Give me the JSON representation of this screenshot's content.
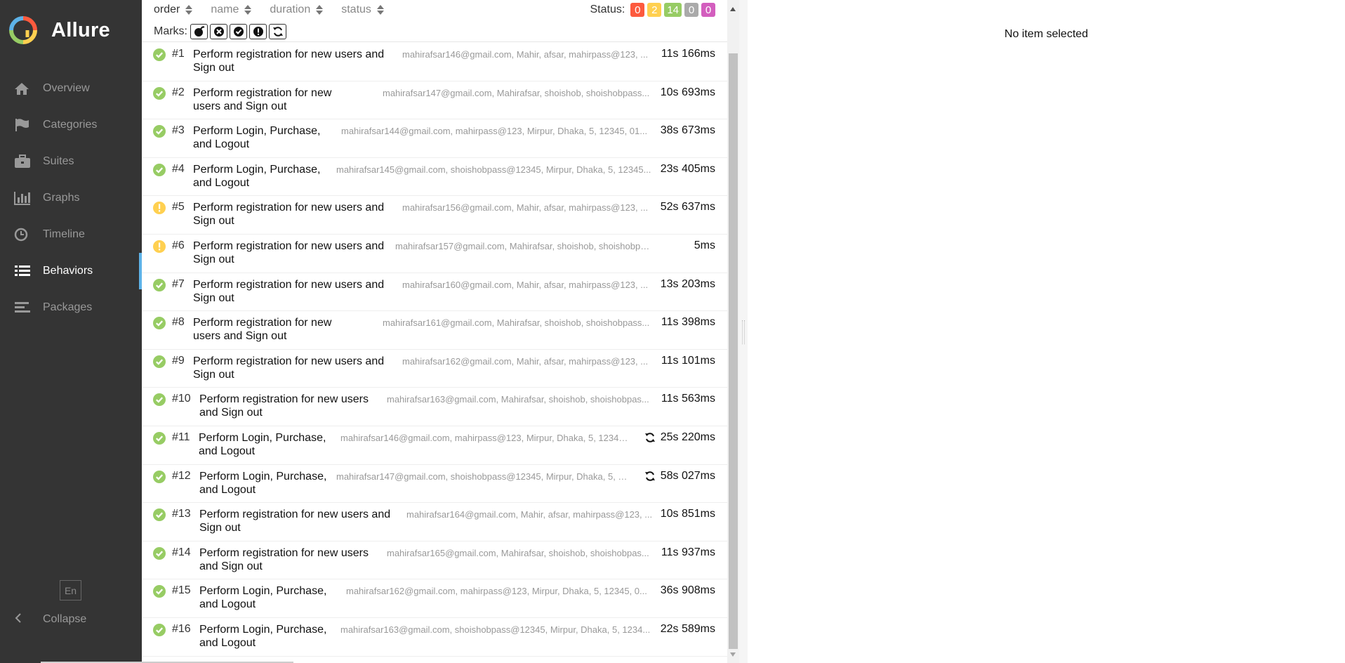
{
  "app": {
    "name": "Allure"
  },
  "sidebar": {
    "items": [
      {
        "label": "Overview",
        "icon": "home-icon"
      },
      {
        "label": "Categories",
        "icon": "flag-icon"
      },
      {
        "label": "Suites",
        "icon": "briefcase-icon"
      },
      {
        "label": "Graphs",
        "icon": "bar-chart-icon"
      },
      {
        "label": "Timeline",
        "icon": "clock-icon"
      },
      {
        "label": "Behaviors",
        "icon": "list-icon",
        "active": true
      },
      {
        "label": "Packages",
        "icon": "align-left-icon"
      }
    ],
    "language": "En",
    "collapse_label": "Collapse"
  },
  "toolbar": {
    "sorters": [
      "order",
      "name",
      "duration",
      "status"
    ],
    "status_label": "Status:",
    "statuses": [
      {
        "count": "0",
        "color": "#fd5a3e"
      },
      {
        "count": "2",
        "color": "#ffd050"
      },
      {
        "count": "14",
        "color": "#97cc64"
      },
      {
        "count": "0",
        "color": "#aaaaaa"
      },
      {
        "count": "0",
        "color": "#d35ebe"
      }
    ],
    "marks_label": "Marks:",
    "marks": [
      "flaky-icon",
      "new-failed-icon",
      "new-passed-icon",
      "new-broken-icon",
      "retries-icon"
    ]
  },
  "tests": [
    {
      "num": "#1",
      "title": "Perform registration for new users and Sign out",
      "params": "mahirafsar146@gmail.com, Mahir, afsar, mahirpass@123, ...",
      "duration": "11s 166ms",
      "status": "passed"
    },
    {
      "num": "#2",
      "title": "Perform registration for new users and Sign out",
      "params": "mahirafsar147@gmail.com, Mahirafsar, shoishob, shoishobpass...",
      "duration": "10s 693ms",
      "status": "passed"
    },
    {
      "num": "#3",
      "title": "Perform Login, Purchase, and Logout",
      "params": "mahirafsar144@gmail.com, mahirpass@123, Mirpur, Dhaka, 5, 12345, 01...",
      "duration": "38s 673ms",
      "status": "passed"
    },
    {
      "num": "#4",
      "title": "Perform Login, Purchase, and Logout",
      "params": "mahirafsar145@gmail.com, shoishobpass@12345, Mirpur, Dhaka, 5, 12345...",
      "duration": "23s 405ms",
      "status": "passed"
    },
    {
      "num": "#5",
      "title": "Perform registration for new users and Sign out",
      "params": "mahirafsar156@gmail.com, Mahir, afsar, mahirpass@123, ...",
      "duration": "52s 637ms",
      "status": "broken"
    },
    {
      "num": "#6",
      "title": "Perform registration for new users and Sign out",
      "params": "mahirafsar157@gmail.com, Mahirafsar, shoishob, shoishobpass@12...",
      "duration": "5ms",
      "status": "broken"
    },
    {
      "num": "#7",
      "title": "Perform registration for new users and Sign out",
      "params": "mahirafsar160@gmail.com, Mahir, afsar, mahirpass@123, ...",
      "duration": "13s 203ms",
      "status": "passed"
    },
    {
      "num": "#8",
      "title": "Perform registration for new users and Sign out",
      "params": "mahirafsar161@gmail.com, Mahirafsar, shoishob, shoishobpass...",
      "duration": "11s 398ms",
      "status": "passed"
    },
    {
      "num": "#9",
      "title": "Perform registration for new users and Sign out",
      "params": "mahirafsar162@gmail.com, Mahir, afsar, mahirpass@123, ...",
      "duration": "11s 101ms",
      "status": "passed"
    },
    {
      "num": "#10",
      "title": "Perform registration for new users and Sign out",
      "params": "mahirafsar163@gmail.com, Mahirafsar, shoishob, shoishobpas...",
      "duration": "11s 563ms",
      "status": "passed"
    },
    {
      "num": "#11",
      "title": "Perform Login, Purchase, and Logout",
      "params": "mahirafsar146@gmail.com, mahirpass@123, Mirpur, Dhaka, 5, 12345,...",
      "duration": "25s 220ms",
      "status": "passed",
      "retry": true
    },
    {
      "num": "#12",
      "title": "Perform Login, Purchase, and Logout",
      "params": "mahirafsar147@gmail.com, shoishobpass@12345, Mirpur, Dhaka, 5, 1...",
      "duration": "58s 027ms",
      "status": "passed",
      "retry": true
    },
    {
      "num": "#13",
      "title": "Perform registration for new users and Sign out",
      "params": "mahirafsar164@gmail.com, Mahir, afsar, mahirpass@123, ...",
      "duration": "10s 851ms",
      "status": "passed"
    },
    {
      "num": "#14",
      "title": "Perform registration for new users and Sign out",
      "params": "mahirafsar165@gmail.com, Mahirafsar, shoishob, shoishobpas...",
      "duration": "11s 937ms",
      "status": "passed"
    },
    {
      "num": "#15",
      "title": "Perform Login, Purchase, and Logout",
      "params": "mahirafsar162@gmail.com, mahirpass@123, Mirpur, Dhaka, 5, 12345, 0...",
      "duration": "36s 908ms",
      "status": "passed"
    },
    {
      "num": "#16",
      "title": "Perform Login, Purchase, and Logout",
      "params": "mahirafsar163@gmail.com, shoishobpass@12345, Mirpur, Dhaka, 5, 1234...",
      "duration": "22s 589ms",
      "status": "passed"
    }
  ],
  "detail": {
    "empty_text": "No item selected"
  },
  "colors": {
    "passed": "#97cc64",
    "broken": "#ffd050",
    "sidebar_bg": "#343434",
    "active_accent": "#5db2e8"
  }
}
